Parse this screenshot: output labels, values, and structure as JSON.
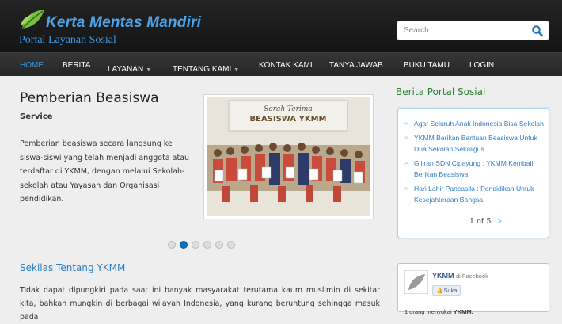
{
  "header": {
    "site_title": "Kerta Mentas Mandiri",
    "site_subtitle": "Portal Layanan Sosial",
    "search": {
      "placeholder": "Search",
      "icon": "search-icon"
    }
  },
  "nav": {
    "items": [
      {
        "label": "HOME",
        "active": true,
        "dropdown": false
      },
      {
        "label": "BERITA",
        "dropdown": false
      },
      {
        "label": "LAYANAN",
        "dropdown": true
      },
      {
        "label": "TENTANG KAMI",
        "dropdown": true
      },
      {
        "label": "KONTAK KAMI",
        "dropdown": false
      },
      {
        "label": "TANYA JAWAB",
        "dropdown": false
      },
      {
        "label": "BUKU TAMU",
        "dropdown": false
      },
      {
        "label": "LOGIN",
        "dropdown": false
      }
    ],
    "caret": "▼"
  },
  "slide": {
    "title": "Pemberian Beasiswa",
    "category": "Service",
    "text": "Pemberian beasiswa secara langsung ke siswa-siswi yang telah menjadi anggota atau terdaftar di YKMM, dengan melalui Sekolah-sekolah atau Yayasan dan Organisasi pendidikan.",
    "photo_banner_line1": "Serah Terima",
    "photo_banner_line2": "BEASISWA YKMM",
    "dots_total": 6,
    "dots_active": 2
  },
  "about": {
    "title": "Sekilas Tentang YKMM",
    "text": "Tidak dapat dipungkiri pada saat ini banyak masyarakat terutama kaum muslimin di sekitar kita, bahkan mungkin di berbagai wilayah Indonesia, yang kurang beruntung sehingga masuk pada"
  },
  "sidebar": {
    "news_title": "Berita Portal Sosial",
    "news": [
      "Agar Seluruh Anak Indonesia Bisa Sekolah",
      "YKMM Berikan Bantuan Beasiswa Untuk Dua Sekolah Sekaligus",
      "Giliran SDN Cipayung : YKMM Kembali Berikan Beasiswa",
      "Hari Lahir Pancasila : Pendidikan Untuk Kesejahteraan Bangsa."
    ],
    "pager": "1 of 5",
    "pager_next": "»",
    "facebook": {
      "name": "YKMM",
      "suffix": "di Facebook",
      "like": "Suka",
      "count_prefix": "1 orang menyukai",
      "count_name": "YKMM."
    }
  },
  "colors": {
    "accent": "#3f9ae0",
    "link": "#2f7ec8",
    "sidebar_title": "#2a8436",
    "header_bg": "#1c1c1c"
  }
}
